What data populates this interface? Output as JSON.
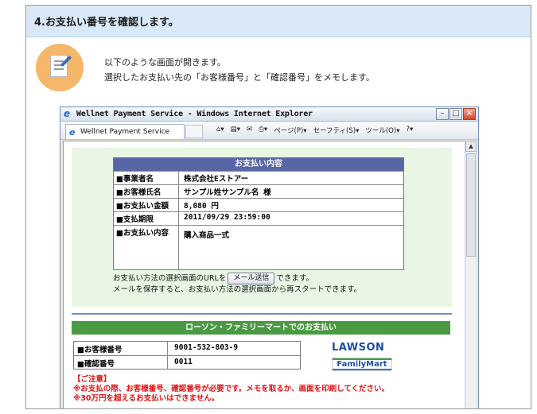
{
  "step": {
    "title": "4.お支払い番号を確認します。"
  },
  "intro": {
    "line1": "以下のような画面が開きます。",
    "line2": "選択したお支払い先の「お客様番号」と「確認番号」をメモします。"
  },
  "browser": {
    "window_title": "Wellnet Payment Service - Windows Internet Explorer",
    "tab_title": "Wellnet Payment Service",
    "commands": {
      "page": "ページ(P)",
      "safety": "セーフティ(S)",
      "tools": "ツール(O)"
    }
  },
  "payment": {
    "header": "お支払い内容",
    "rows": [
      {
        "label": "■事業者名",
        "value": "株式会社Eストアー"
      },
      {
        "label": "■お客様氏名",
        "value": "サンプル姓サンプル名 様"
      },
      {
        "label": "■お支払い金額",
        "value": "8,080 円"
      },
      {
        "label": "■支払期限",
        "value": "2011/09/29 23:59:00"
      },
      {
        "label": "■お支払い内容",
        "value": "購入商品一式"
      }
    ],
    "mail_before": "お支払い方法の選択画面のURLを",
    "mail_button": "メール送信",
    "mail_after": "できます。",
    "mail_line2": "メールを保存すると、お支払い方法の選択画面から再スタートできます。"
  },
  "store": {
    "header": "ローソン・ファミリーマートでのお支払い",
    "rows": [
      {
        "label": "■お客様番号",
        "value": "9001-532-803-9"
      },
      {
        "label": "■確認番号",
        "value": "0011"
      }
    ],
    "logo_lawson": "LAWSON",
    "logo_familymart": "FamilyMart",
    "notice_title": "【ご注意】",
    "notice_line1": "※お支払の際、お客様番号、確認番号が必要です。メモを取るか、画面を印刷してください。",
    "notice_line2": "※30万円を超えるお支払いはできません。"
  }
}
